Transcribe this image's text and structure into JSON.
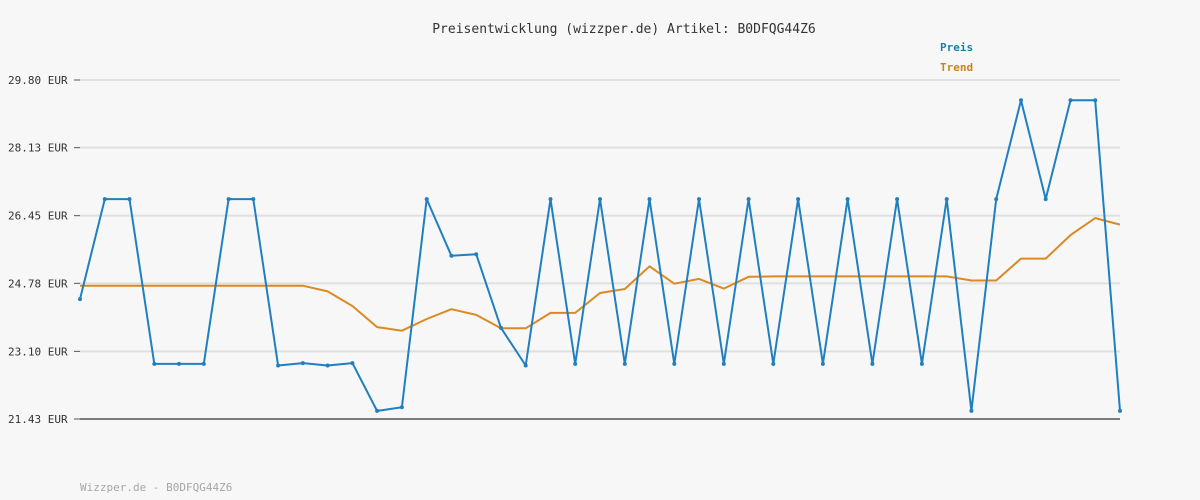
{
  "chart_data": {
    "type": "line",
    "title": "Preisentwicklung (wizzper.de) Artikel: B0DFQG44Z6",
    "xlabel": "",
    "ylabel": "",
    "y_tick_labels": [
      "29.80 EUR",
      "28.13 EUR",
      "26.45 EUR",
      "24.78 EUR",
      "23.10 EUR",
      "21.43 EUR"
    ],
    "y_ticks": [
      29.8,
      28.13,
      26.45,
      24.78,
      23.1,
      21.43
    ],
    "ylim": [
      21.43,
      29.8
    ],
    "grid": true,
    "legend_position": "top-right",
    "x_count": 43,
    "series": [
      {
        "name": "Preis",
        "color": "#1f7fc0",
        "values": [
          24.39,
          26.86,
          26.86,
          22.79,
          22.79,
          22.79,
          26.86,
          26.86,
          22.75,
          22.81,
          22.75,
          22.81,
          21.63,
          21.72,
          26.86,
          25.46,
          25.5,
          23.68,
          22.75,
          26.86,
          22.79,
          26.86,
          22.79,
          26.86,
          22.79,
          26.86,
          22.79,
          26.86,
          22.79,
          26.86,
          22.79,
          26.86,
          22.79,
          26.86,
          22.79,
          26.86,
          21.63,
          26.86,
          29.3,
          26.86,
          29.3,
          29.3,
          21.63
        ]
      },
      {
        "name": "Trend",
        "color": "#db8a22",
        "values": [
          24.72,
          24.72,
          24.72,
          24.72,
          24.72,
          24.72,
          24.72,
          24.72,
          24.72,
          24.72,
          24.58,
          24.22,
          23.7,
          23.61,
          23.9,
          24.14,
          24.0,
          23.67,
          23.67,
          24.05,
          24.05,
          24.54,
          24.64,
          25.2,
          24.77,
          24.89,
          24.65,
          24.94,
          24.95,
          24.95,
          24.95,
          24.95,
          24.95,
          24.95,
          24.95,
          24.95,
          24.85,
          24.85,
          25.39,
          25.39,
          25.97,
          26.39,
          26.23
        ]
      }
    ]
  },
  "footer": {
    "text": "Wizzper.de - B0DFQG44Z6"
  }
}
